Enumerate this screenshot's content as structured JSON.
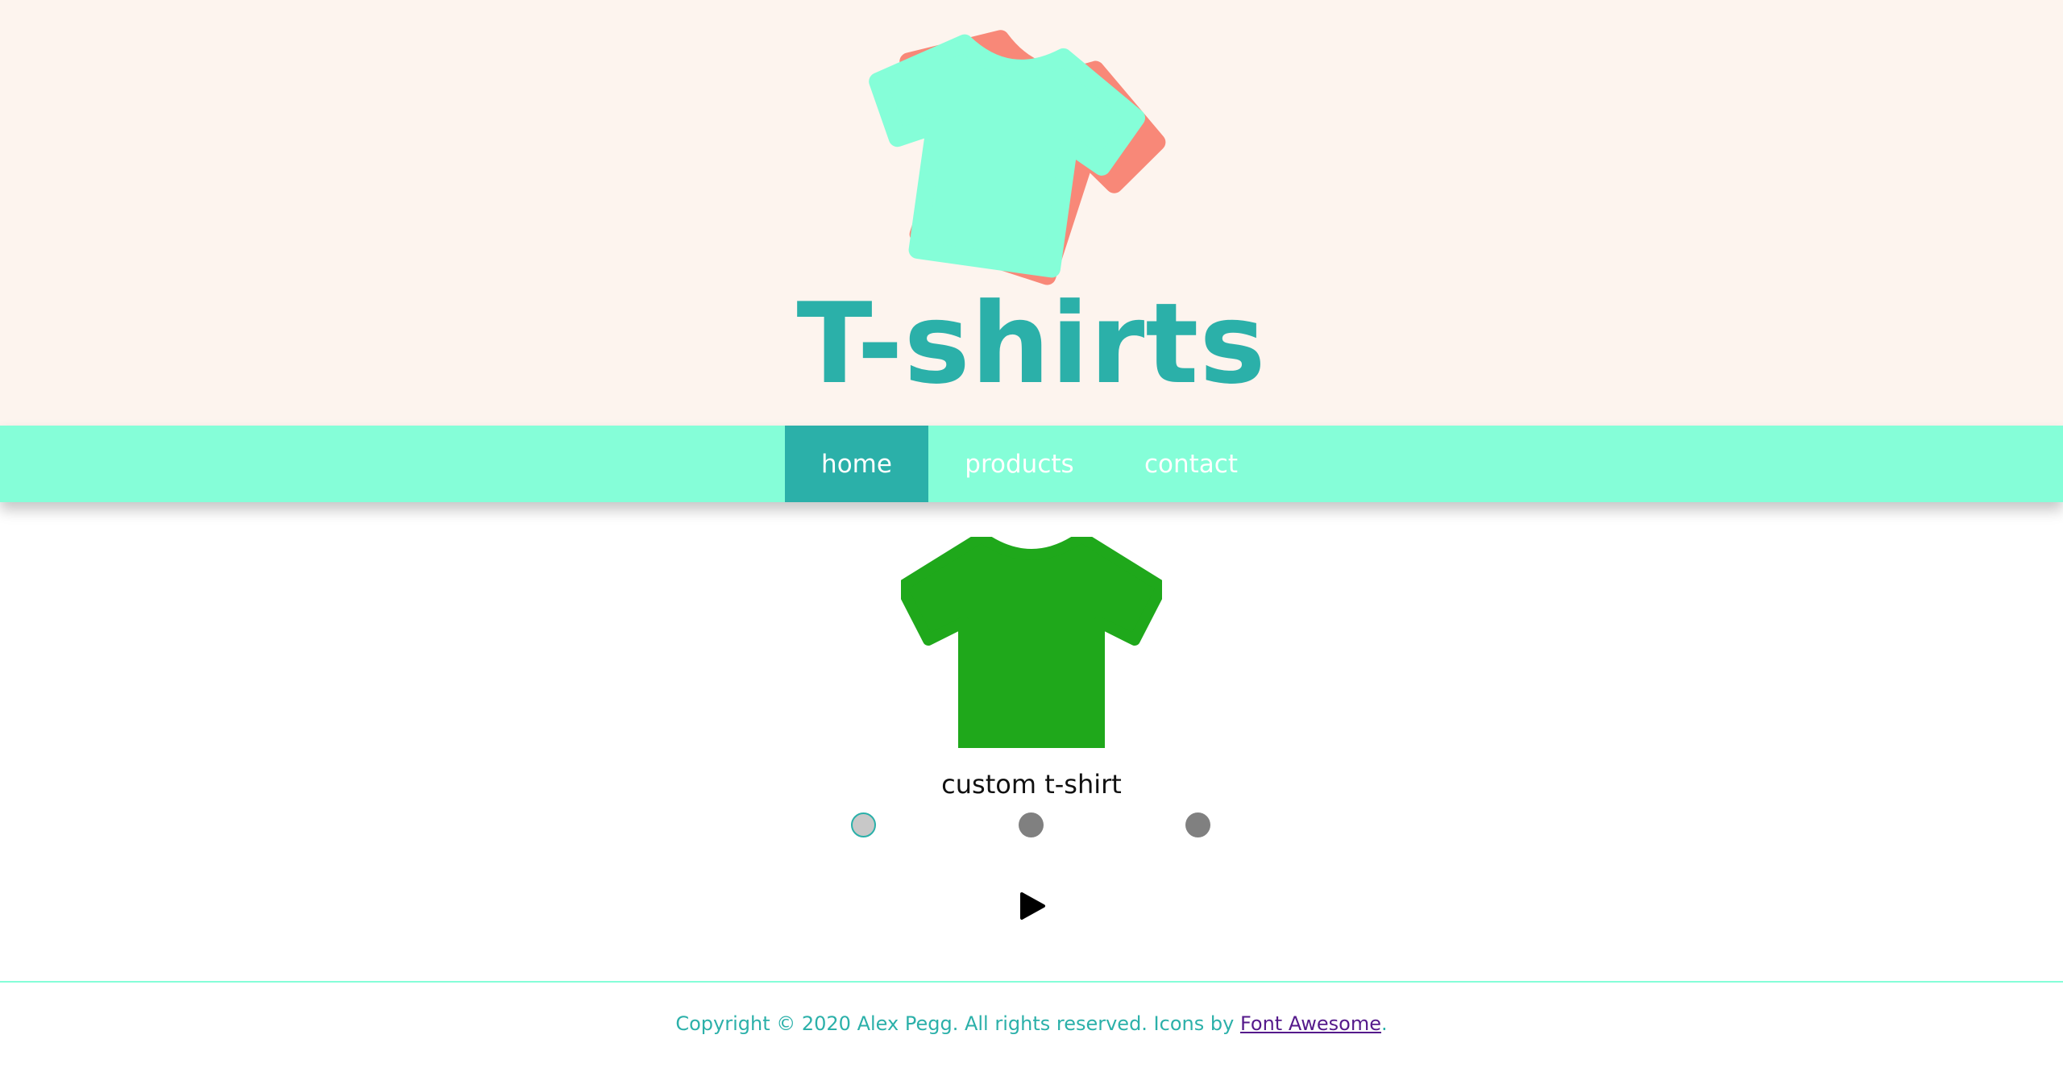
{
  "header": {
    "title": "T-shirts",
    "logo_icon": "stacked-tshirts-icon",
    "colors": {
      "background": "#fdf4ee",
      "front_shirt": "#85fed8",
      "back_shirt": "#f88878",
      "title": "#2bb0a9"
    }
  },
  "nav": {
    "items": [
      {
        "label": "home",
        "active": true
      },
      {
        "label": "products",
        "active": false
      },
      {
        "label": "contact",
        "active": false
      }
    ],
    "colors": {
      "bar": "#85fed8",
      "active": "#2bb0a9",
      "text": "#ffffff"
    }
  },
  "slideshow": {
    "image_icon": "tshirt-icon",
    "image_color": "#1fa81b",
    "caption": "custom t-shirt",
    "slide_count": 3,
    "active_slide": 1,
    "play_icon": "play-icon"
  },
  "footer": {
    "copyright": "Copyright © 2020 Alex Pegg. All rights reserved. Icons by ",
    "link_text": "Font Awesome",
    "suffix": "."
  }
}
